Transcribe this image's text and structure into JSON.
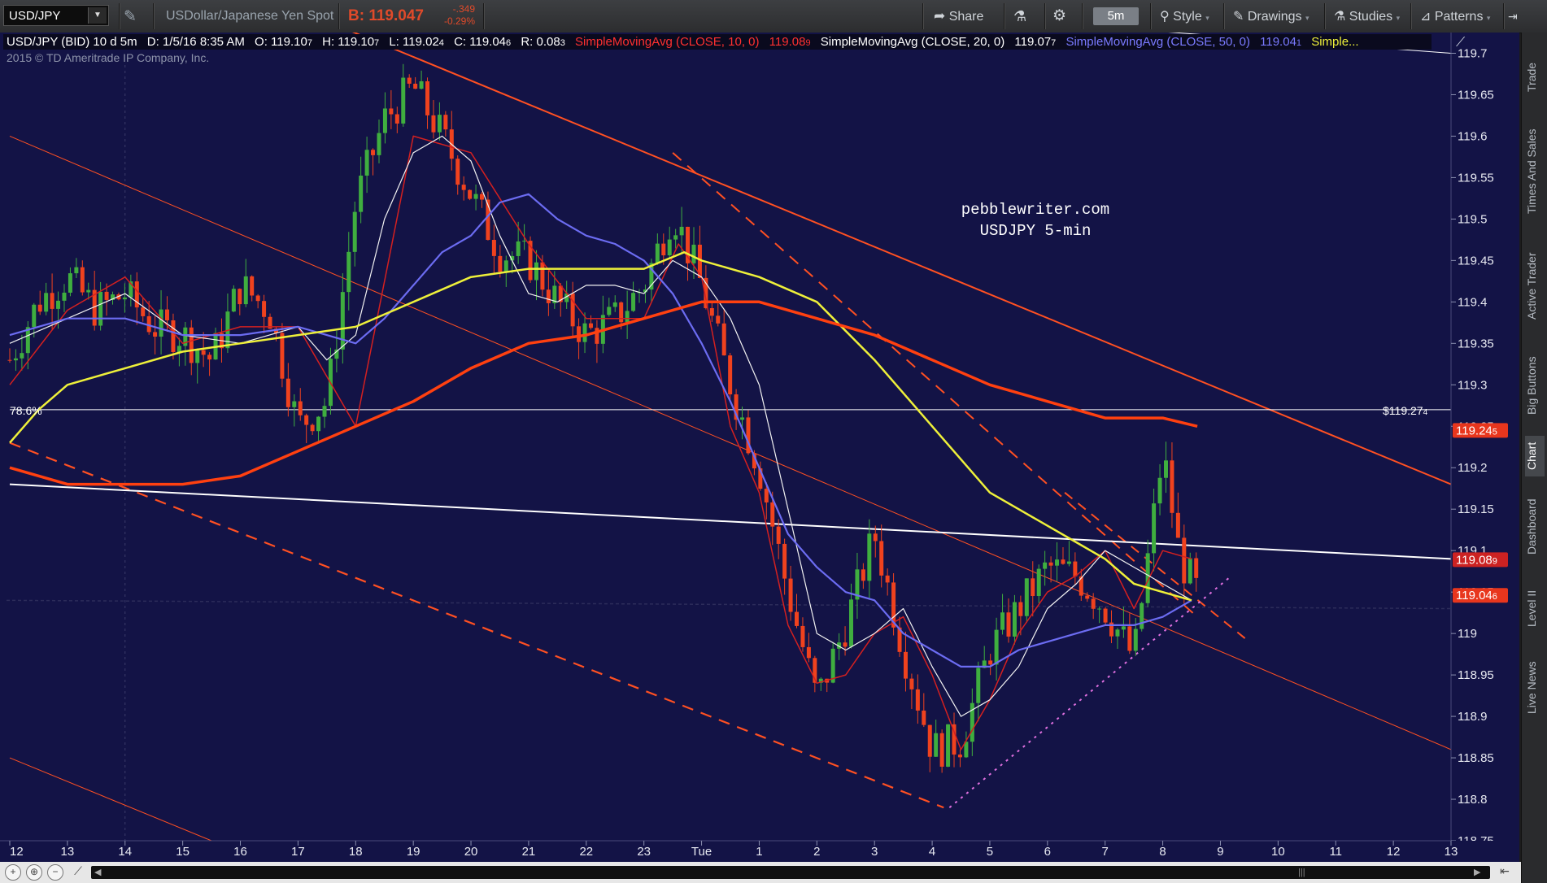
{
  "toolbar": {
    "symbol": "USD/JPY",
    "description": "USDollar/Japanese Yen Spot",
    "bid": "B: 119.047",
    "change": "-.349",
    "change_pct": "-0.29%",
    "share_label": "Share",
    "timeframe": "5m",
    "style_label": "Style",
    "drawings_label": "Drawings",
    "studies_label": "Studies",
    "patterns_label": "Patterns"
  },
  "header_line": {
    "symbol_info": "USD/JPY (BID) 10 d 5m",
    "date": "D: 1/5/16 8:35 AM",
    "open": "O: 119.10",
    "open_small": "7",
    "high": "H: 119.10",
    "high_small": "7",
    "low": "L: 119.02",
    "low_small": "4",
    "close": "C: 119.04",
    "close_small": "6",
    "range": "R: 0.08",
    "range_small": "3",
    "sma10_label": "SimpleMovingAvg (CLOSE, 10, 0)",
    "sma10_value": "119.08",
    "sma10_small": "9",
    "sma20_label": "SimpleMovingAvg (CLOSE, 20, 0)",
    "sma20_value": "119.07",
    "sma20_small": "7",
    "sma50_label": "SimpleMovingAvg (CLOSE, 50, 0)",
    "sma50_value": "119.04",
    "sma50_small": "1",
    "sma_more_label": "Simple..."
  },
  "copyright": "2015 © TD Ameritrade IP Company, Inc.",
  "annotation": {
    "line1": "pebblewriter.com",
    "line2": "USDJPY 5-min"
  },
  "fib_label": "78.6%",
  "fib_price_label": "$119.27",
  "fib_price_small": "4",
  "price_tags": [
    {
      "value": "119.24",
      "small": "5",
      "price": 119.245,
      "color": "#e8361d"
    },
    {
      "value": "119.08",
      "small": "9",
      "price": 119.089,
      "color": "#cc2222"
    },
    {
      "value": "119.04",
      "small": "6",
      "price": 119.046,
      "color": "#e8361d"
    }
  ],
  "colors": {
    "background": "#131346",
    "grid": "#2a2a6a",
    "up_candle": "#3fae3f",
    "down_candle": "#f0421e",
    "sma10": "#d42020",
    "sma20": "#f2f2f2",
    "sma50": "#6c6cf2",
    "sma_yellow": "#eef03a",
    "sma_orange": "#ff4010",
    "trendline": "#ff5022",
    "pink_dotted": "#e070e0"
  },
  "side_tabs": [
    "Trade",
    "Times And Sales",
    "Active Trader",
    "Big Buttons",
    "Chart",
    "Dashboard",
    "Level II",
    "Live News"
  ],
  "chart_data": {
    "type": "candlestick",
    "title": "",
    "xlabel": "",
    "ylabel": "",
    "ylim": [
      118.75,
      119.725
    ],
    "y_ticks": [
      119.7,
      119.65,
      119.6,
      119.55,
      119.5,
      119.45,
      119.4,
      119.35,
      119.3,
      119.25,
      119.2,
      119.15,
      119.1,
      119.05,
      119,
      118.95,
      118.9,
      118.85,
      118.8,
      118.75
    ],
    "y_tick_labels": [
      "119.7",
      "119.65",
      "119.6",
      "119.55",
      "119.5",
      "119.45",
      "119.4",
      "119.35",
      "119.3",
      "119.25",
      "119.2",
      "119.15",
      "119.1",
      "119.05",
      "119",
      "118.95",
      "118.9",
      "118.85",
      "118.8",
      "118.75"
    ],
    "x_labels": [
      "12",
      "13",
      "14",
      "15",
      "16",
      "17",
      "18",
      "19",
      "20",
      "21",
      "22",
      "23",
      "Tue",
      "1",
      "2",
      "3",
      "4",
      "5",
      "6",
      "7",
      "8",
      "9",
      "10",
      "11",
      "12",
      "13"
    ],
    "x_ticks": [
      0,
      1,
      2,
      3,
      4,
      5,
      6,
      7,
      8,
      9,
      10,
      11,
      12,
      13,
      14,
      15,
      16,
      17,
      18,
      19,
      20,
      21,
      22,
      23,
      24,
      25
    ],
    "xlim": [
      -0.05,
      25
    ],
    "grid": false,
    "series": [
      {
        "name": "USD/JPY (BID) 10 d 5m",
        "x": [
          0,
          0.5,
          1,
          1.5,
          2,
          2.5,
          3,
          3.5,
          4,
          4.5,
          5,
          5.5,
          6,
          6.5,
          7,
          7.5,
          8,
          8.5,
          9,
          9.5,
          10,
          10.5,
          11,
          11.5,
          12,
          12.5,
          13,
          13.5,
          14,
          14.5,
          15,
          15.5,
          16,
          16.5,
          17,
          17.5,
          18,
          18.5,
          19,
          19.5,
          20,
          20.3,
          20.6
        ],
        "close": [
          119.33,
          119.4,
          119.43,
          119.39,
          119.41,
          119.37,
          119.36,
          119.33,
          119.42,
          119.39,
          119.25,
          119.28,
          119.52,
          119.62,
          119.66,
          119.6,
          119.53,
          119.46,
          119.45,
          119.4,
          119.36,
          119.38,
          119.42,
          119.51,
          119.42,
          119.3,
          119.2,
          119.05,
          118.92,
          119.01,
          119.12,
          118.98,
          118.86,
          118.87,
          118.98,
          119.03,
          119.08,
          119.07,
          119.03,
          118.97,
          119.22,
          119.09,
          119.05
        ]
      },
      {
        "name": "SMA 10",
        "x": [
          0,
          1,
          2,
          3,
          4,
          5,
          6,
          7,
          8,
          9,
          10,
          11,
          11.6,
          12,
          12.5,
          13,
          13.5,
          14,
          14.5,
          15,
          15.5,
          16,
          16.5,
          17,
          17.5,
          18,
          18.5,
          19,
          19.5,
          20,
          20.5
        ],
        "values": [
          119.3,
          119.39,
          119.43,
          119.35,
          119.37,
          119.37,
          119.25,
          119.6,
          119.58,
          119.47,
          119.38,
          119.38,
          119.47,
          119.43,
          119.25,
          119.17,
          119.01,
          118.94,
          118.95,
          119.0,
          119.02,
          118.95,
          118.86,
          118.92,
          119.0,
          119.05,
          119.07,
          119.1,
          119.03,
          119.1,
          119.09
        ]
      },
      {
        "name": "SMA 20",
        "x": [
          0,
          1,
          2,
          3,
          4,
          5,
          5.5,
          6,
          6.5,
          7,
          7.5,
          8,
          8.5,
          9,
          9.5,
          10,
          10.5,
          11,
          11.5,
          12,
          12.5,
          13,
          13.5,
          14,
          14.5,
          15,
          15.5,
          16,
          16.5,
          17,
          17.5,
          18,
          18.5,
          19,
          19.5,
          20,
          20.5
        ],
        "values": [
          119.35,
          119.38,
          119.41,
          119.36,
          119.35,
          119.37,
          119.33,
          119.36,
          119.5,
          119.58,
          119.6,
          119.57,
          119.48,
          119.41,
          119.4,
          119.42,
          119.42,
          119.41,
          119.45,
          119.43,
          119.38,
          119.3,
          119.15,
          119.0,
          118.98,
          119.0,
          119.03,
          118.96,
          118.9,
          118.92,
          118.96,
          119.03,
          119.06,
          119.1,
          119.08,
          119.06,
          119.04
        ]
      },
      {
        "name": "SMA 50",
        "x": [
          0,
          1,
          2,
          3,
          4,
          5,
          5.5,
          6,
          6.5,
          7,
          7.5,
          8,
          8.5,
          9,
          9.5,
          10,
          10.5,
          11,
          11.5,
          12,
          12.5,
          13,
          13.5,
          14,
          14.5,
          15,
          15.5,
          16,
          16.5,
          17,
          17.5,
          18,
          18.5,
          19,
          19.5,
          20,
          20.5
        ],
        "values": [
          119.36,
          119.38,
          119.38,
          119.36,
          119.36,
          119.37,
          119.36,
          119.35,
          119.38,
          119.42,
          119.46,
          119.48,
          119.52,
          119.53,
          119.5,
          119.48,
          119.47,
          119.45,
          119.41,
          119.35,
          119.28,
          119.2,
          119.12,
          119.08,
          119.05,
          119.04,
          119.0,
          118.98,
          118.96,
          118.96,
          118.98,
          118.99,
          119.0,
          119.01,
          119.01,
          119.02,
          119.04
        ]
      },
      {
        "name": "SMA yellow",
        "x": [
          0,
          0.5,
          1,
          2,
          3,
          4,
          5,
          6,
          7,
          8,
          9,
          10,
          11,
          11.7,
          12,
          13,
          14,
          15,
          16,
          17,
          18,
          18.5,
          19,
          19.5,
          20,
          20.5
        ],
        "values": [
          119.23,
          119.27,
          119.3,
          119.32,
          119.34,
          119.35,
          119.36,
          119.37,
          119.4,
          119.43,
          119.44,
          119.44,
          119.44,
          119.46,
          119.45,
          119.43,
          119.4,
          119.33,
          119.25,
          119.17,
          119.13,
          119.11,
          119.09,
          119.06,
          119.05,
          119.04
        ]
      },
      {
        "name": "SMA orange",
        "x": [
          0,
          1,
          2,
          3,
          4,
          5,
          6,
          7,
          8,
          9,
          10,
          11,
          12,
          13,
          14,
          15,
          16,
          17,
          18,
          19,
          20,
          20.6
        ],
        "values": [
          119.2,
          119.18,
          119.18,
          119.18,
          119.19,
          119.22,
          119.25,
          119.28,
          119.32,
          119.35,
          119.36,
          119.38,
          119.4,
          119.4,
          119.38,
          119.36,
          119.33,
          119.3,
          119.28,
          119.26,
          119.26,
          119.25
        ]
      }
    ]
  }
}
